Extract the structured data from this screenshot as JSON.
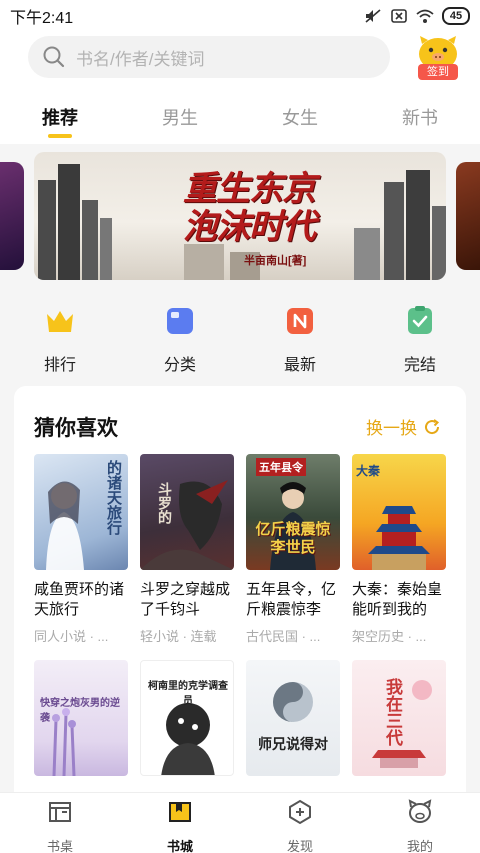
{
  "status_bar": {
    "time": "下午2:41",
    "battery": "45"
  },
  "search": {
    "placeholder": "书名/作者/关键词"
  },
  "checkin": {
    "label": "签到"
  },
  "tabs": [
    {
      "label": "推荐",
      "active": true
    },
    {
      "label": "男生"
    },
    {
      "label": "女生"
    },
    {
      "label": "新书"
    }
  ],
  "banner": {
    "title_line1": "重生东京",
    "title_line2": "泡沫时代",
    "author": "半亩南山[著]"
  },
  "quick_nav": [
    {
      "label": "排行",
      "icon": "crown-icon",
      "color": "#f7c31a"
    },
    {
      "label": "分类",
      "icon": "category-icon",
      "color": "#5b7cf0"
    },
    {
      "label": "最新",
      "icon": "new-icon",
      "color": "#f2603f"
    },
    {
      "label": "完结",
      "icon": "done-icon",
      "color": "#5cc08a"
    }
  ],
  "guess": {
    "title": "猜你喜欢",
    "refresh_label": "换一换",
    "books": [
      {
        "title": "咸鱼贾环的诸天旅行",
        "meta": "同人小说 · ...",
        "cover_text": "的诸天旅行"
      },
      {
        "title": "斗罗之穿越成了千钧斗",
        "meta": "轻小说 · 连载",
        "cover_text": "斗罗的"
      },
      {
        "title": "五年县令，亿斤粮震惊李",
        "meta": "古代民国 · ...",
        "cover_text": "亿斤粮震惊李世民",
        "cover_top": "五年县令"
      },
      {
        "title": "大秦：秦始皇能听到我的",
        "meta": "架空历史 · ...",
        "cover_text": "大秦"
      },
      {
        "title": "",
        "meta": "",
        "cover_text": "快穿之炮灰男的逆袭"
      },
      {
        "title": "",
        "meta": "",
        "cover_text": "柯南里的克学调查员"
      },
      {
        "title": "",
        "meta": "",
        "cover_text": "师兄说得对"
      },
      {
        "title": "",
        "meta": "",
        "cover_text": "我在三代"
      }
    ]
  },
  "bottom_nav": [
    {
      "label": "书桌",
      "icon": "bookshelf-icon"
    },
    {
      "label": "书城",
      "icon": "bookstore-icon",
      "active": true
    },
    {
      "label": "发现",
      "icon": "discover-icon"
    },
    {
      "label": "我的",
      "icon": "profile-icon"
    }
  ],
  "colors": {
    "accent": "#f7c31a",
    "refresh": "#e6a817",
    "checkin": "#f5574a"
  }
}
